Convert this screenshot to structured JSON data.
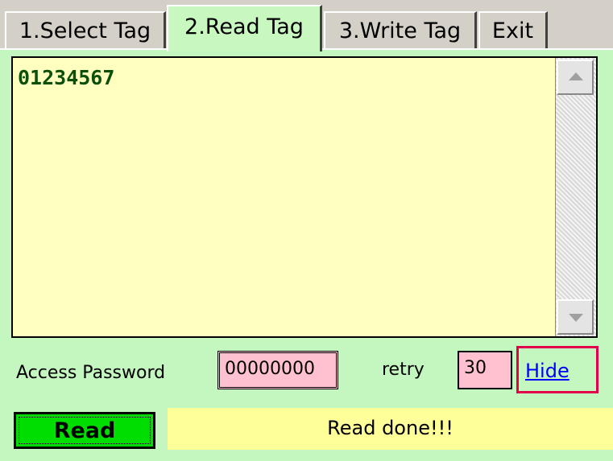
{
  "tabs": [
    {
      "label": "1.Select Tag"
    },
    {
      "label": "2.Read Tag"
    },
    {
      "label": "3.Write Tag"
    },
    {
      "label": "Exit"
    }
  ],
  "active_tab": "2.Read Tag",
  "output": {
    "text": "01234567"
  },
  "access_password": {
    "label": "Access Password",
    "value": "00000000"
  },
  "retry": {
    "label": "retry",
    "value": "30"
  },
  "hide_link": "Hide",
  "read_button": "Read",
  "status_text": "Read done!!!",
  "colors": {
    "panel": "#c4f6c0",
    "text_area": "#ffffc0",
    "input_fields": "#ffc0d0",
    "read_button": "#00dd00",
    "status_bar": "#ffff99",
    "hide_highlight": "#e0004c"
  }
}
